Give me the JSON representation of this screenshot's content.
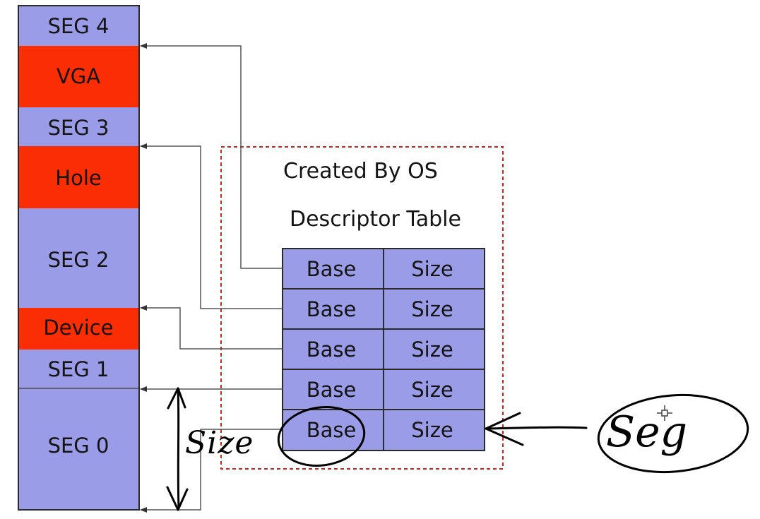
{
  "memory": {
    "segments": [
      {
        "label": "SEG 4",
        "kind": "segment"
      },
      {
        "label": "VGA",
        "kind": "reserved"
      },
      {
        "label": "SEG 3",
        "kind": "segment"
      },
      {
        "label": "Hole",
        "kind": "reserved"
      },
      {
        "label": "SEG 2",
        "kind": "segment"
      },
      {
        "label": "Device",
        "kind": "reserved"
      },
      {
        "label": "SEG 1",
        "kind": "segment"
      },
      {
        "label": "SEG 0",
        "kind": "segment"
      }
    ]
  },
  "descriptor_box": {
    "created_by": "Created By OS",
    "title": "Descriptor Table",
    "rows": [
      {
        "base": "Base",
        "size": "Size"
      },
      {
        "base": "Base",
        "size": "Size"
      },
      {
        "base": "Base",
        "size": "Size"
      },
      {
        "base": "Base",
        "size": "Size"
      },
      {
        "base": "Base",
        "size": "Size"
      }
    ]
  },
  "annotations": {
    "size_note": "Size",
    "seg_note": "Seg"
  },
  "colors": {
    "segment_fill": "#9a9ce8",
    "reserved_fill": "#fb2d05",
    "table_fill": "#9a9ce8",
    "dashed_border": "#d62020",
    "arrow_line": "#555555"
  }
}
